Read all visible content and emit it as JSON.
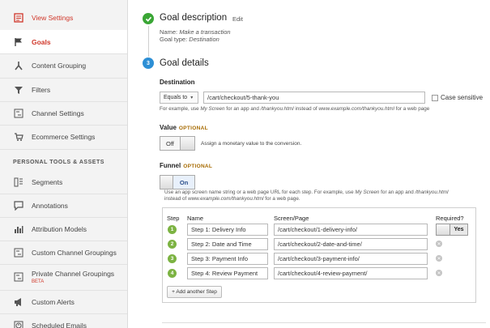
{
  "sidebar": {
    "items": [
      {
        "label": "View Settings",
        "sub": "",
        "icon": "view-settings-icon"
      },
      {
        "label": "Goals",
        "sub": "",
        "icon": "flag-icon"
      },
      {
        "label": "Content Grouping",
        "sub": "",
        "icon": "content-grouping-icon"
      },
      {
        "label": "Filters",
        "sub": "",
        "icon": "filter-icon"
      },
      {
        "label": "Channel Settings",
        "sub": "",
        "icon": "channel-settings-icon"
      },
      {
        "label": "Ecommerce Settings",
        "sub": "",
        "icon": "cart-icon"
      },
      {
        "label": "Segments",
        "sub": "",
        "icon": "segments-icon"
      },
      {
        "label": "Annotations",
        "sub": "",
        "icon": "annotation-icon"
      },
      {
        "label": "Attribution Models",
        "sub": "",
        "icon": "attribution-icon"
      },
      {
        "label": "Custom Channel Groupings",
        "sub": "",
        "icon": "custom-channel-icon"
      },
      {
        "label": "Private Channel Groupings",
        "sub": "BETA",
        "icon": "private-channel-icon"
      },
      {
        "label": "Custom Alerts",
        "sub": "",
        "icon": "megaphone-icon"
      },
      {
        "label": "Scheduled Emails",
        "sub": "",
        "icon": "clock-icon"
      }
    ],
    "section_heading": "PERSONAL TOOLS & ASSETS"
  },
  "goal_description": {
    "title": "Goal description",
    "edit": "Edit",
    "name_label": "Name:",
    "name_value": "Make a transaction",
    "type_label": "Goal type:",
    "type_value": "Destination"
  },
  "goal_details": {
    "step_number": "3",
    "title": "Goal details",
    "destination": {
      "label": "Destination",
      "match_type": "Equals to",
      "value": "/cart/checkout/5-thank-you",
      "case_sensitive_label": "Case sensitive",
      "hint_1": "For example, use ",
      "hint_2": "My Screen",
      "hint_3": " for an app and ",
      "hint_4": "/thankyou.html",
      "hint_5": " instead of ",
      "hint_6": "www.example.com/thankyou.html",
      "hint_7": " for a web page"
    },
    "value": {
      "label": "Value",
      "optional": "OPTIONAL",
      "toggle": "Off",
      "hint": "Assign a monetary value to the conversion."
    },
    "funnel": {
      "label": "Funnel",
      "optional": "OPTIONAL",
      "toggle": "On",
      "hint_a1": "Use an app screen name string or a web page URL for each step. For example, use ",
      "hint_a2": "My Screen",
      "hint_a3": " for an app and ",
      "hint_a4": "/thankyou.html",
      "hint_b1": "instead of ",
      "hint_b2": "www.example.com/thankyou.html",
      "hint_b3": " for a web page.",
      "columns": {
        "step": "Step",
        "name": "Name",
        "screen": "Screen/Page",
        "required": "Required?"
      },
      "required_value": "Yes",
      "steps": [
        {
          "num": "1",
          "name": "Step 1: Delivery Info",
          "page": "/cart/checkout/1-delivery-info/"
        },
        {
          "num": "2",
          "name": "Step 2: Date and Time",
          "page": "/cart/checkout/2-date-and-time/"
        },
        {
          "num": "3",
          "name": "Step 3: Payment Info",
          "page": "/cart/checkout/3-payment-info/"
        },
        {
          "num": "4",
          "name": "Step 4: Review Payment",
          "page": "/cart/checkout/4-review-payment/"
        }
      ],
      "add_step": "+ Add another Step"
    }
  },
  "colors": {
    "accent_red": "#d0372a",
    "check_green": "#3aa635",
    "step_blue": "#2d8fd5",
    "funnel_green": "#7cb342"
  }
}
